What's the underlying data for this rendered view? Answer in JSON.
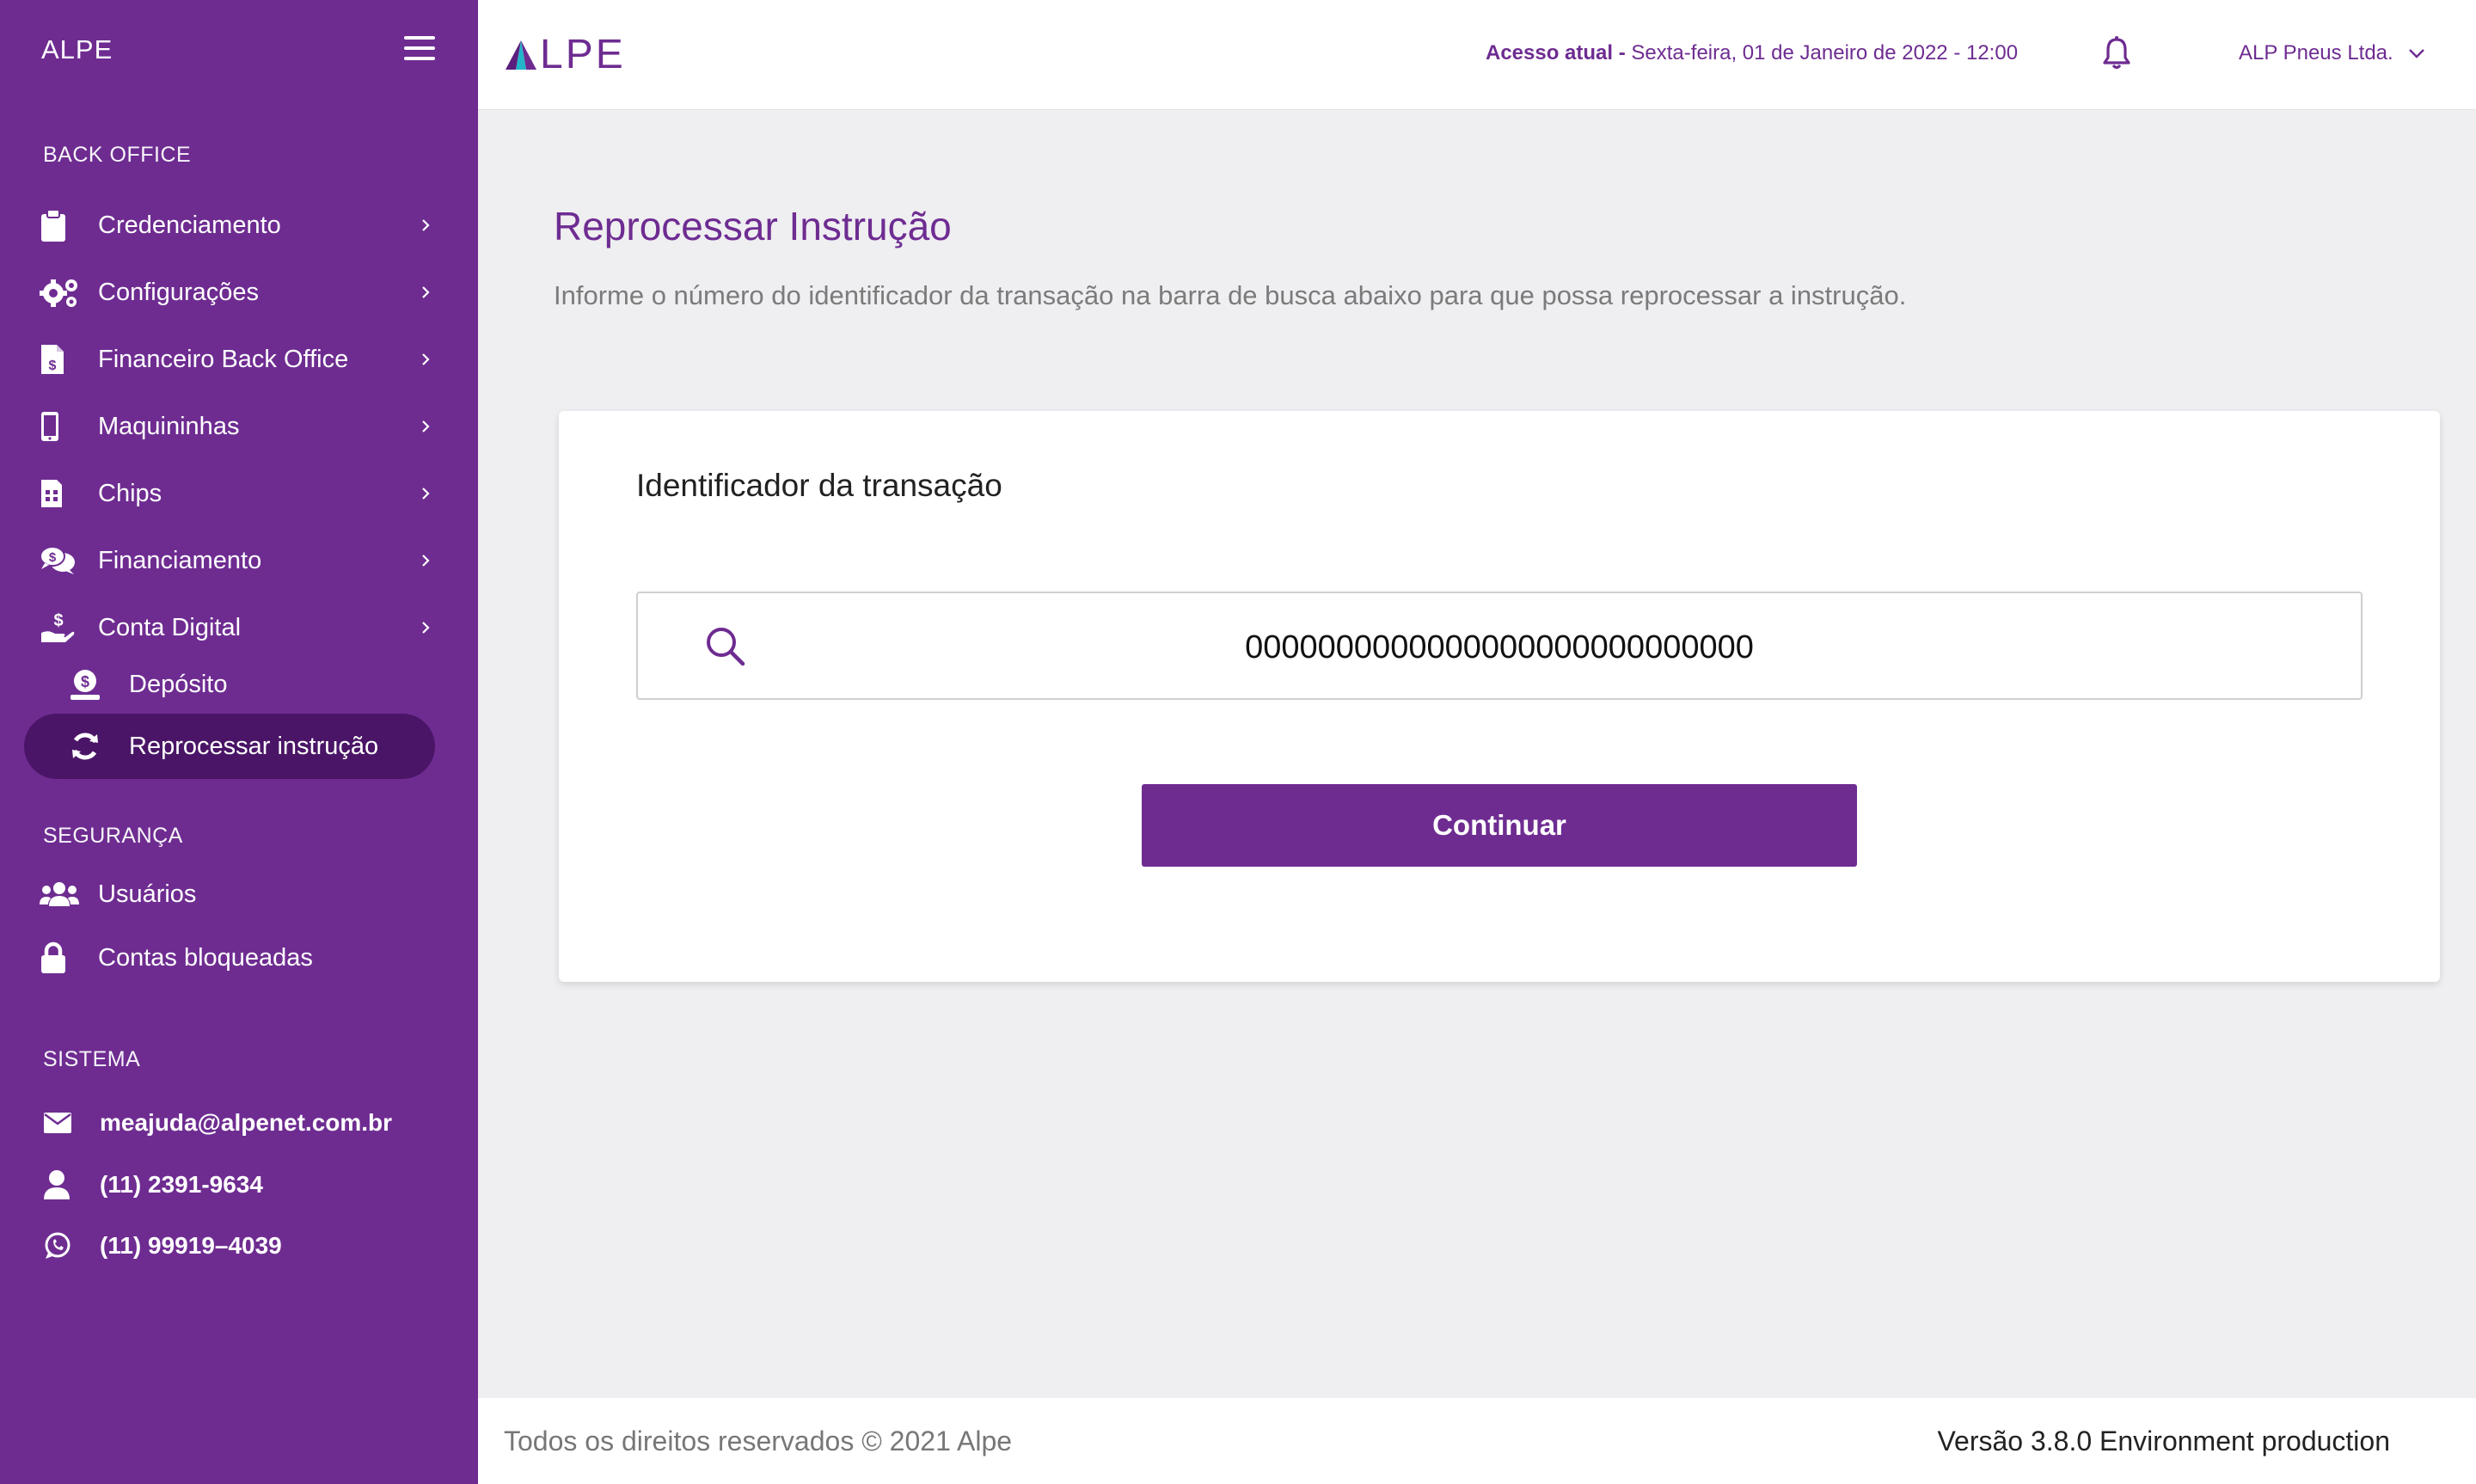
{
  "sidebar": {
    "brand": "ALPE",
    "sections": {
      "backoffice": "BACK OFFICE",
      "seguranca": "SEGURANÇA",
      "sistema": "SISTEMA"
    },
    "items": [
      {
        "label": "Credenciamento",
        "icon": "clipboard-icon"
      },
      {
        "label": "Configurações",
        "icon": "gears-icon"
      },
      {
        "label": "Financeiro Back Office",
        "icon": "invoice-dollar-icon"
      },
      {
        "label": "Maquininhas",
        "icon": "mobile-icon"
      },
      {
        "label": "Chips",
        "icon": "sim-card-icon"
      },
      {
        "label": "Financiamento",
        "icon": "comments-dollar-icon"
      },
      {
        "label": "Conta Digital",
        "icon": "hand-dollar-icon"
      }
    ],
    "subitems": [
      {
        "label": "Depósito",
        "icon": "deposit-icon"
      },
      {
        "label": "Reprocessar instrução",
        "icon": "sync-icon",
        "active": true
      }
    ],
    "security_items": [
      {
        "label": "Usuários",
        "icon": "users-icon"
      },
      {
        "label": "Contas bloqueadas",
        "icon": "lock-icon"
      }
    ],
    "contacts": [
      {
        "label": "meajuda@alpenet.com.br",
        "icon": "envelope-icon"
      },
      {
        "label": "(11) 2391-9634",
        "icon": "user-icon"
      },
      {
        "label": "(11) 99919–4039",
        "icon": "whatsapp-icon"
      }
    ]
  },
  "header": {
    "logo": "LPE",
    "access_label": "Acesso atual -",
    "access_value": "Sexta-feira, 01 de Janeiro  de 2022 - 12:00",
    "company": "ALP Pneus Ltda."
  },
  "main": {
    "title": "Reprocessar Instrução",
    "description": "Informe o número do identificador da transação na barra de busca abaixo para que possa reprocessar a instrução.",
    "card_title": "Identificador da transação",
    "search_value": "0000000000000000000000000000",
    "button": "Continuar"
  },
  "footer": {
    "left": "Todos os direitos reservados © 2021 Alpe",
    "right": "Versão 3.8.0 Environment production"
  },
  "colors": {
    "primary": "#6e2c91",
    "active": "#4a1566",
    "background": "#efeef1"
  }
}
